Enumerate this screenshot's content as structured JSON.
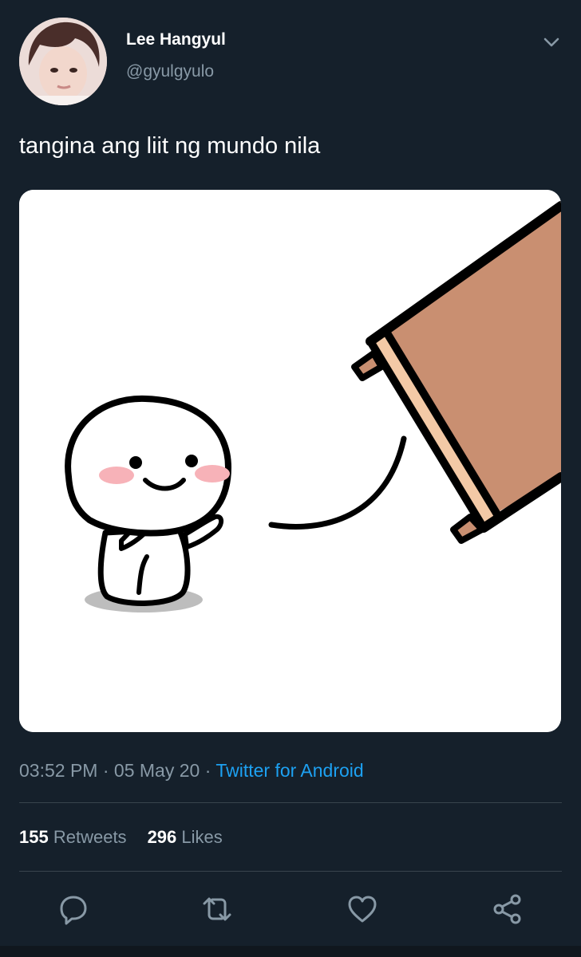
{
  "author": {
    "display_name": "Lee Hangyul",
    "handle": "@gyulgyulo"
  },
  "tweet": {
    "text": "tangina ang liit ng mundo nila",
    "time": "03:52 PM",
    "date": "05 May 20",
    "separator": " · ",
    "source": "Twitter for Android"
  },
  "stats": {
    "retweets_count": "155",
    "retweets_label": "Retweets",
    "likes_count": "296",
    "likes_label": "Likes"
  },
  "icons": {
    "menu": "chevron-down-icon",
    "reply": "reply-icon",
    "retweet": "retweet-icon",
    "like": "heart-icon",
    "share": "share-icon"
  },
  "colors": {
    "background": "#15202b",
    "secondary_text": "#8899a6",
    "accent": "#1da1f2",
    "divider": "#38444d"
  }
}
